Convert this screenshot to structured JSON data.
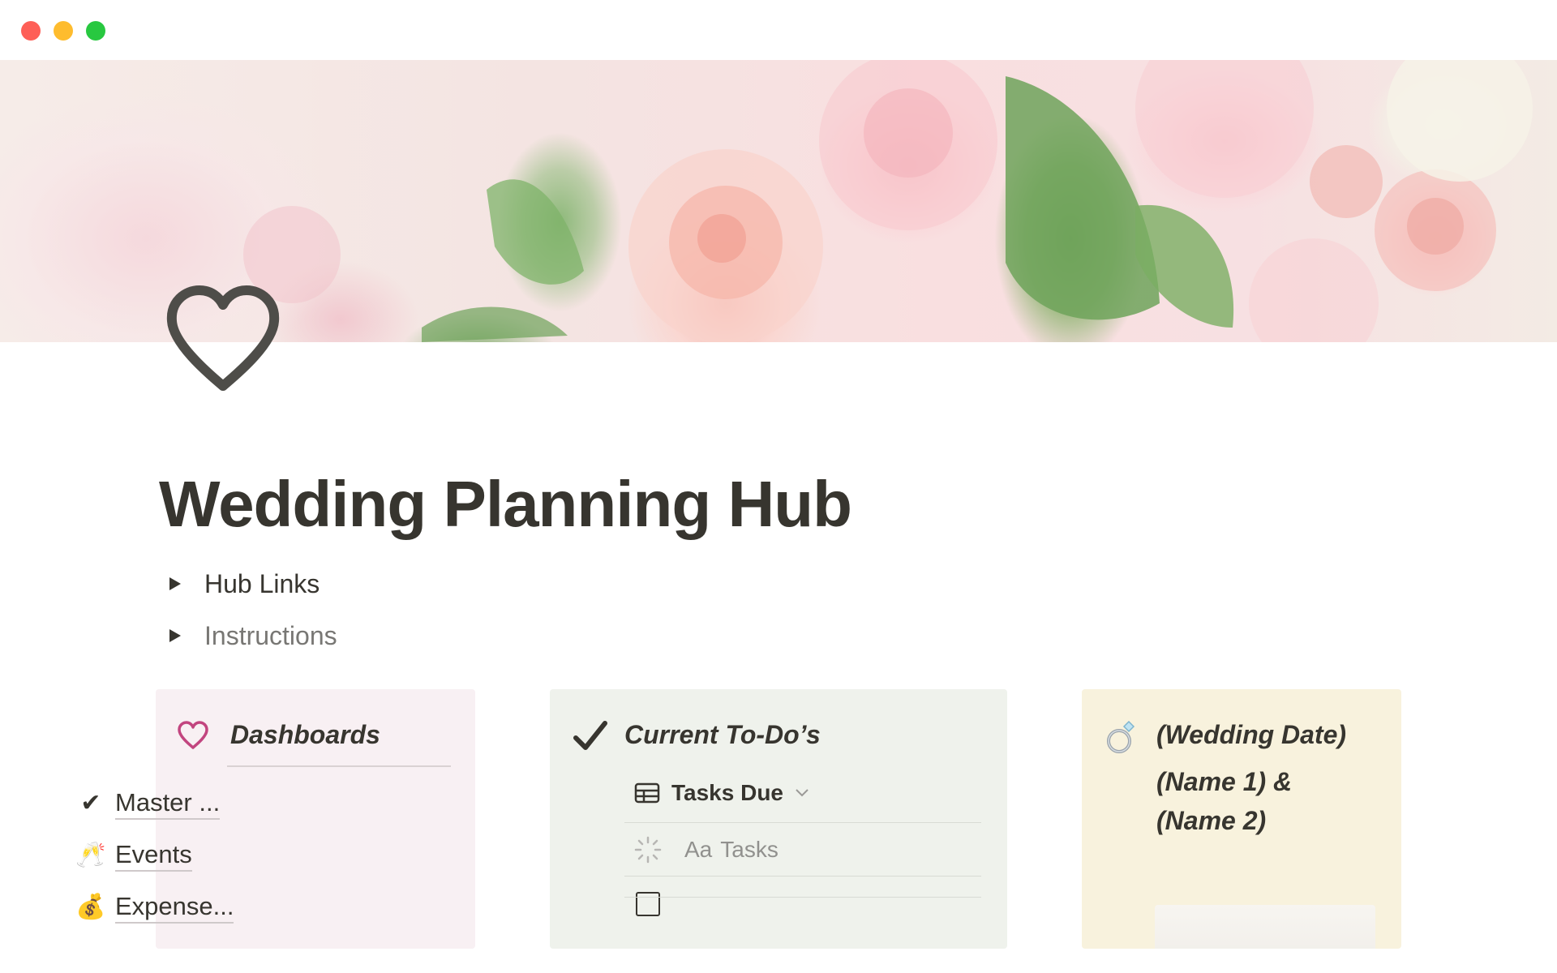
{
  "window": {
    "controls": [
      "close",
      "minimize",
      "zoom"
    ]
  },
  "cover": {
    "description_icon": "roses-cover-image"
  },
  "page": {
    "icon": "heart-outline-icon",
    "title": "Wedding Planning Hub"
  },
  "toggles": [
    {
      "label": "Hub Links"
    },
    {
      "label": "Instructions"
    }
  ],
  "dashboards": {
    "icon": "heart-outline-pink-icon",
    "heading": "Dashboards",
    "links": [
      {
        "icon": "✔",
        "label": "Master ..."
      },
      {
        "icon": "🥂",
        "label": "Events"
      },
      {
        "icon": "💰",
        "label": "Expense..."
      }
    ]
  },
  "todos": {
    "icon": "checkmark-icon",
    "heading": "Current To-Do’s",
    "view": {
      "label": "Tasks Due",
      "icon": "table-icon"
    },
    "column": {
      "type_label": "Aa",
      "label": "Tasks"
    },
    "rows": [
      {
        "text": "(partially hidden row)"
      }
    ]
  },
  "wedding": {
    "icon": "ring-icon",
    "date": "(Wedding Date)",
    "names_line1": "(Name 1) &",
    "names_line2": "(Name 2)"
  },
  "colors": {
    "dashboards_bg": "#f8f0f3",
    "todos_bg": "#eff2ec",
    "wedding_bg": "#f8f2dd",
    "heart_pink": "#c2457f",
    "text": "#37352f",
    "muted": "#787774"
  }
}
